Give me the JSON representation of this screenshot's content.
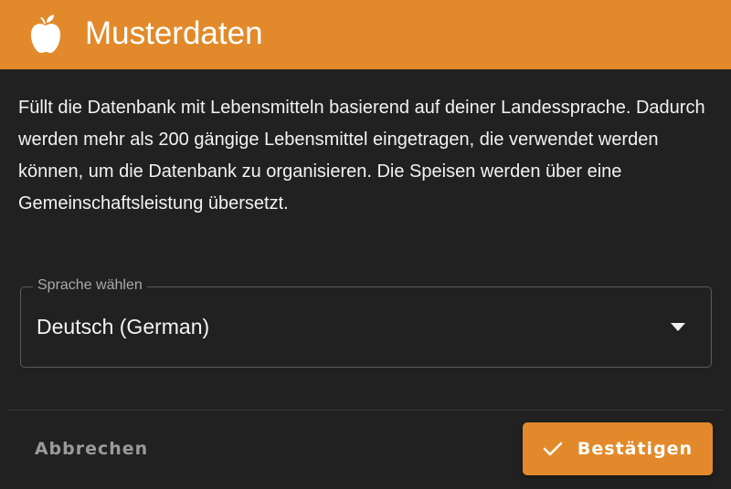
{
  "colors": {
    "accent": "#e28a2b",
    "background": "#212121",
    "header_text": "#ffffff"
  },
  "header": {
    "icon": "apple-icon",
    "title": "Musterdaten"
  },
  "content": {
    "description": "Füllt die Datenbank mit Lebensmitteln basierend auf deiner Landessprache. Dadurch werden mehr als 200 gängige Lebensmittel eingetragen, die verwendet werden können, um die Datenbank zu organisieren. Die Speisen werden über eine Gemeinschaftsleistung übersetzt."
  },
  "language_select": {
    "label": "Sprache wählen",
    "value": "Deutsch (German)",
    "icon": "dropdown-arrow-icon"
  },
  "actions": {
    "cancel_label": "Abbrechen",
    "confirm_label": "Bestätigen",
    "confirm_icon": "check-icon"
  }
}
